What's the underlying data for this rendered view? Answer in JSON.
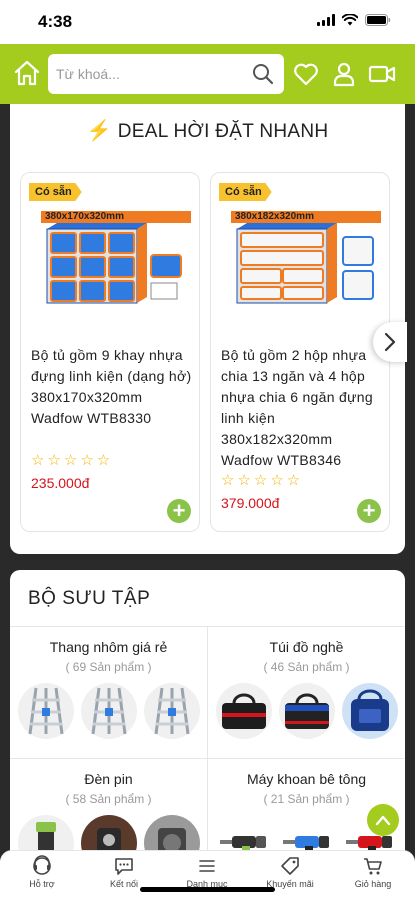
{
  "status_bar": {
    "time": "4:38"
  },
  "header": {
    "search_placeholder": "Từ khoá..."
  },
  "deal": {
    "title": "DEAL HỜI ĐẶT NHANH",
    "products": [
      {
        "badge": "Có sẵn",
        "dimension": "380x170x320mm",
        "name": "Bộ tủ gồm 9 khay nhựa đựng linh kiện (dạng hở) 380x170x320mm Wadfow WTB8330",
        "rating": 0,
        "stars": "☆☆☆☆☆",
        "price": "235.000đ"
      },
      {
        "badge": "Có sẵn",
        "dimension": "380x182x320mm",
        "name": "Bộ tủ gồm 2 hộp nhựa chia 13 ngăn và 4 hộp nhựa chia 6 ngăn đựng linh kiện 380x182x320mm Wadfow WTB8346",
        "rating": 0,
        "stars": "☆☆☆☆☆",
        "price": "379.000đ"
      }
    ]
  },
  "collection": {
    "title": "BỘ SƯU TẬP",
    "items": [
      {
        "name": "Thang nhôm giá rẻ",
        "count": "( 69 Sản phẩm )"
      },
      {
        "name": "Túi đồ nghề",
        "count": "( 46 Sản phẩm )"
      },
      {
        "name": "Đèn pin",
        "count": "( 58 Sản phẩm )"
      },
      {
        "name": "Máy khoan bê tông",
        "count": "( 21 Sản phẩm )"
      }
    ]
  },
  "bottom_nav": [
    {
      "label": "Hỗ trợ",
      "icon": "support-icon"
    },
    {
      "label": "Kết nối",
      "icon": "chat-icon"
    },
    {
      "label": "Danh mục",
      "icon": "menu-icon"
    },
    {
      "label": "Khuyến mãi",
      "icon": "tag-icon"
    },
    {
      "label": "Giỏ hàng",
      "icon": "cart-icon"
    }
  ],
  "colors": {
    "brand_green": "#a3cc1f",
    "price_red": "#d4151c",
    "star": "#f5b301",
    "add_green": "#8bc34a"
  }
}
